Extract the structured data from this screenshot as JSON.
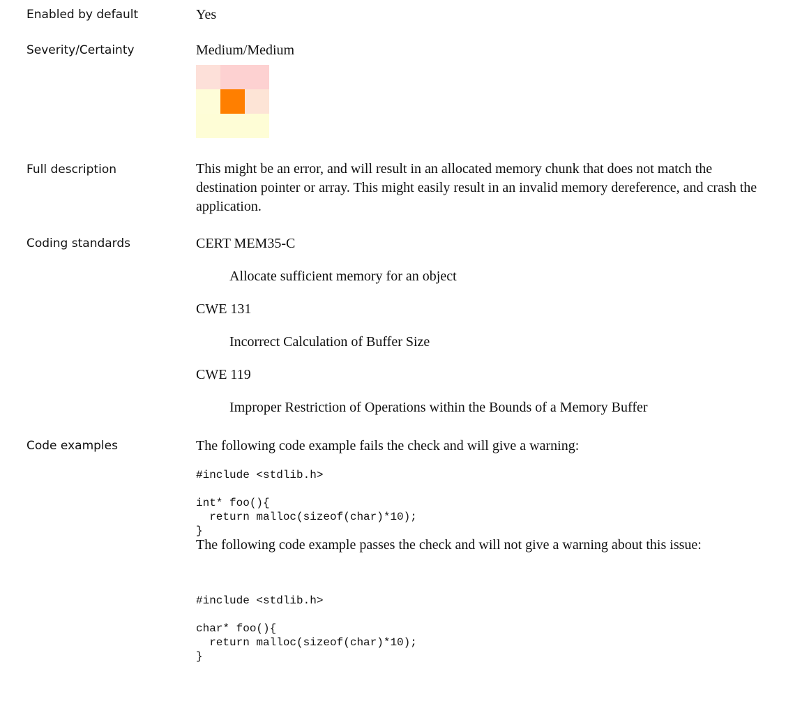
{
  "rows": {
    "enabled": {
      "label": "Enabled by default",
      "value": "Yes"
    },
    "severity": {
      "label": "Severity/Certainty",
      "value": "Medium/Medium",
      "matrix_colors": [
        [
          "#fde0d9",
          "#fdd1d1",
          "#fdd1d1"
        ],
        [
          "#fefdd8",
          "#ff7f00",
          "#fde4d6"
        ],
        [
          "#fefdd6",
          "#fefdd6",
          "#fefdd6"
        ]
      ]
    },
    "description": {
      "label": "Full description",
      "text": " This might be an error, and will result in an allocated memory chunk that does not match the destination pointer or array.  This might easily result in an invalid memory dereference, and crash the application."
    },
    "standards": {
      "label": "Coding standards",
      "items": [
        {
          "id": "CERT MEM35-C",
          "title": "Allocate sufficient memory for an object"
        },
        {
          "id": "CWE 131",
          "title": "Incorrect Calculation of Buffer Size"
        },
        {
          "id": "CWE 119",
          "title": "Improper Restriction of Operations within the Bounds of a Memory Buffer"
        }
      ]
    },
    "examples": {
      "label": "Code examples",
      "fail_intro": "The following code example fails the check and will give a warning:",
      "fail_code": "#include <stdlib.h>\n\nint* foo(){\n  return malloc(sizeof(char)*10);\n}",
      "pass_intro": "The following code example passes the check and will not give a warning about this issue:",
      "pass_code": "#include <stdlib.h>\n\nchar* foo(){\n  return malloc(sizeof(char)*10);\n}"
    }
  }
}
